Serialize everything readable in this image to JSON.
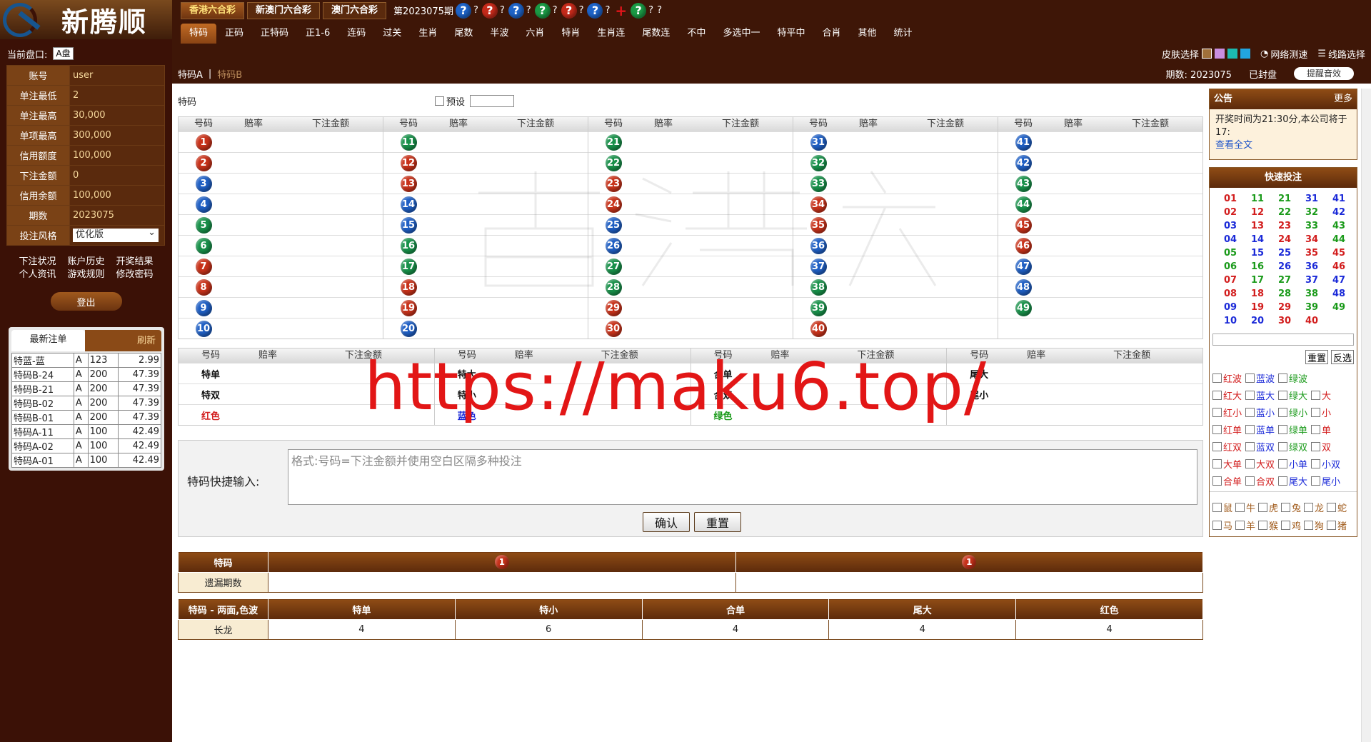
{
  "logo": {
    "title": "新腾顺"
  },
  "account": {
    "pan_label": "当前盘口:",
    "pan_value": "A盘",
    "rows": [
      [
        "账号",
        "user"
      ],
      [
        "单注最低",
        "2"
      ],
      [
        "单注最高",
        "30,000"
      ],
      [
        "单项最高",
        "300,000"
      ],
      [
        "信用额度",
        "100,000"
      ],
      [
        "下注金额",
        "0"
      ],
      [
        "信用余额",
        "100,000"
      ],
      [
        "期数",
        "2023075"
      ]
    ],
    "style_label": "投注风格",
    "style_value": "优化版"
  },
  "links": [
    "下注状况",
    "账户历史",
    "开奖结果",
    "个人资讯",
    "游戏规则",
    "修改密码"
  ],
  "logout": "登出",
  "recent": {
    "tab": "最新注单",
    "refresh": "刷新",
    "rows": [
      [
        "特蓝-蓝",
        "A",
        "123",
        "2.99"
      ],
      [
        "特码B-24",
        "A",
        "200",
        "47.39"
      ],
      [
        "特码B-21",
        "A",
        "200",
        "47.39"
      ],
      [
        "特码B-02",
        "A",
        "200",
        "47.39"
      ],
      [
        "特码B-01",
        "A",
        "200",
        "47.39"
      ],
      [
        "特码A-11",
        "A",
        "100",
        "42.49"
      ],
      [
        "特码A-02",
        "A",
        "100",
        "42.49"
      ],
      [
        "特码A-01",
        "A",
        "100",
        "42.49"
      ]
    ]
  },
  "lottery_tabs": [
    "香港六合彩",
    "新澳门六合彩",
    "澳门六合彩"
  ],
  "period_text": "第2023075期",
  "menu": [
    "特码",
    "正码",
    "正特码",
    "正1-6",
    "连码",
    "过关",
    "生肖",
    "尾数",
    "半波",
    "六肖",
    "特肖",
    "生肖连",
    "尾数连",
    "不中",
    "多选中一",
    "特平中",
    "合肖",
    "其他",
    "统计"
  ],
  "toolbar": {
    "skin": "皮肤选择",
    "speed": "网络测速",
    "line": "线路选择"
  },
  "subbar": {
    "tab_a": "特码A",
    "sep": "|",
    "tab_b": "特码B",
    "period_label": "期数: 2023075",
    "status": "已封盘",
    "sound": "提醒音效"
  },
  "main": {
    "title": "特码",
    "preset": "预设",
    "hdr": {
      "num": "号码",
      "odds": "赔率",
      "amount": "下注金额"
    }
  },
  "side_rows": [
    [
      "特单",
      "特大",
      "合单",
      "尾大"
    ],
    [
      "特双",
      "特小",
      "合双",
      "尾小"
    ],
    [
      "红色",
      "蓝色",
      "绿色",
      ""
    ]
  ],
  "quick": {
    "label": "特码快捷输入:",
    "placeholder": "格式:号码=下注金额并使用空白区隔多种投注",
    "confirm": "确认",
    "reset": "重置"
  },
  "miss": {
    "h1": "特码",
    "row_label": "遗漏期数",
    "ball": "1"
  },
  "long": {
    "headers": [
      "特码 - 两面,色波",
      "特单",
      "特小",
      "合单",
      "尾大",
      "红色"
    ],
    "row": [
      "长龙",
      "4",
      "6",
      "4",
      "4",
      "4"
    ]
  },
  "notice": {
    "title": "公告",
    "more": "更多",
    "text": "开奖时间为21:30分,本公司将于17:",
    "link": "查看全文"
  },
  "qbet": {
    "title": "快速投注",
    "reset": "重置",
    "invert": "反选",
    "opts": [
      [
        "红波",
        "蓝波",
        "绿波",
        ""
      ],
      [
        "红大",
        "蓝大",
        "绿大",
        "大"
      ],
      [
        "红小",
        "蓝小",
        "绿小",
        "小"
      ],
      [
        "红单",
        "蓝单",
        "绿单",
        "单"
      ],
      [
        "红双",
        "蓝双",
        "绿双",
        "双"
      ],
      [
        "大单",
        "大双",
        "小单",
        "小双"
      ],
      [
        "合单",
        "合双",
        "尾大",
        "尾小"
      ]
    ],
    "zodiac": [
      "鼠",
      "牛",
      "虎",
      "兔",
      "龙",
      "蛇",
      "马",
      "羊",
      "猴",
      "鸡",
      "狗",
      "猪"
    ]
  },
  "overlay": {
    "url": "https://maku6.top/"
  },
  "colors": {
    "red": "#c8321a",
    "blue": "#1f5fc4",
    "green": "#18914a",
    "brown": "#3e1607"
  }
}
